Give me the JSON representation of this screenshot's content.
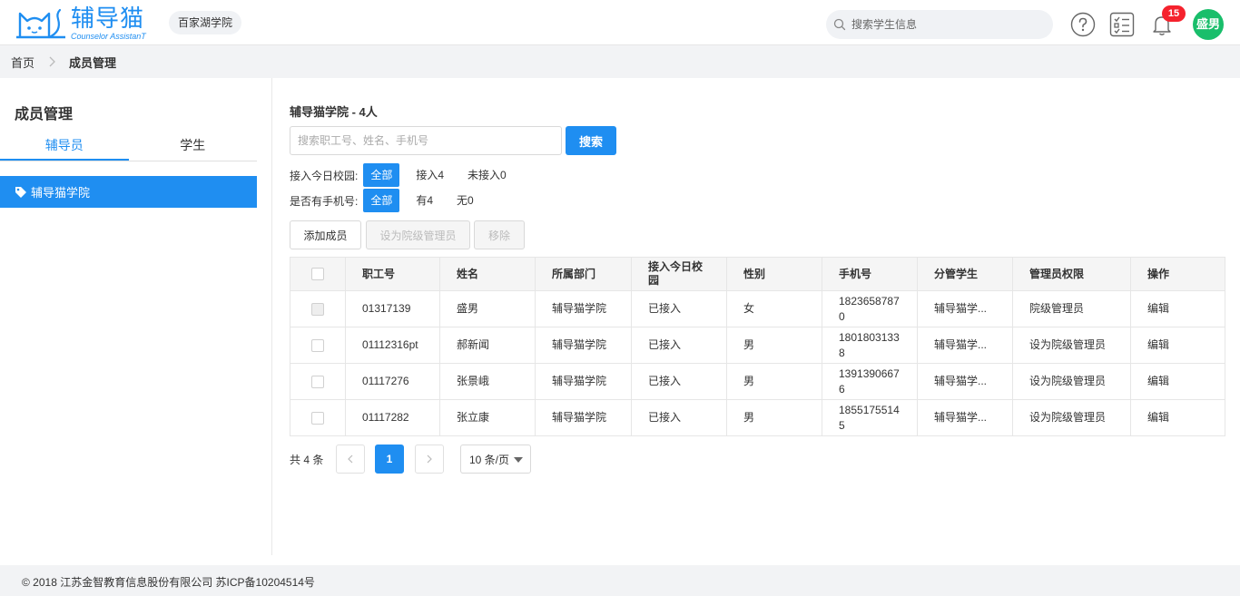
{
  "header": {
    "logo_cn": "辅导猫",
    "logo_en": "Counselor AssistanT",
    "school": "百家湖学院",
    "search_placeholder": "搜索学生信息",
    "notification_count": "15",
    "user_avatar": "盛男",
    "brand_color": "#1f8ef1"
  },
  "breadcrumb": {
    "home": "首页",
    "current": "成员管理"
  },
  "left": {
    "title": "成员管理",
    "tabs": [
      {
        "label": "辅导员",
        "active": true
      },
      {
        "label": "学生",
        "active": false
      }
    ],
    "tree_item": "辅导猫学院"
  },
  "main": {
    "title": "辅导猫学院 - 4人",
    "search_placeholder": "搜索职工号、姓名、手机号",
    "search_button": "搜索",
    "filters": [
      {
        "label": "接入今日校园:",
        "options": [
          "全部",
          "接入4",
          "未接入0"
        ]
      },
      {
        "label": "是否有手机号:",
        "options": [
          "全部",
          "有4",
          "无0"
        ]
      }
    ],
    "actions": {
      "add": "添加成员",
      "set_admin": "设为院级管理员",
      "remove": "移除"
    },
    "table": {
      "headers": [
        "职工号",
        "姓名",
        "所属部门",
        "接入今日校园",
        "性别",
        "手机号",
        "分管学生",
        "管理员权限",
        "操作"
      ],
      "rows": [
        {
          "id": "01317139",
          "name": "盛男",
          "dept": "辅导猫学院",
          "joined": "已接入",
          "gender": "女",
          "phone": "18236587870",
          "students": "辅导猫学...",
          "permission": "院级管理员",
          "action": "编辑"
        },
        {
          "id": "01112316pt",
          "name": "郝新闻",
          "dept": "辅导猫学院",
          "joined": "已接入",
          "gender": "男",
          "phone": "18018031338",
          "students": "辅导猫学...",
          "permission": "设为院级管理员",
          "action": "编辑"
        },
        {
          "id": "01117276",
          "name": "张景峨",
          "dept": "辅导猫学院",
          "joined": "已接入",
          "gender": "男",
          "phone": "13913906676",
          "students": "辅导猫学...",
          "permission": "设为院级管理员",
          "action": "编辑"
        },
        {
          "id": "01117282",
          "name": "张立康",
          "dept": "辅导猫学院",
          "joined": "已接入",
          "gender": "男",
          "phone": "18551755145",
          "students": "辅导猫学...",
          "permission": "设为院级管理员",
          "action": "编辑"
        }
      ]
    },
    "pagination": {
      "total": "共 4 条",
      "current_page": "1",
      "page_size": "10 条/页"
    }
  },
  "footer": {
    "text": "© 2018 江苏金智教育信息股份有限公司 苏ICP备10204514号"
  }
}
